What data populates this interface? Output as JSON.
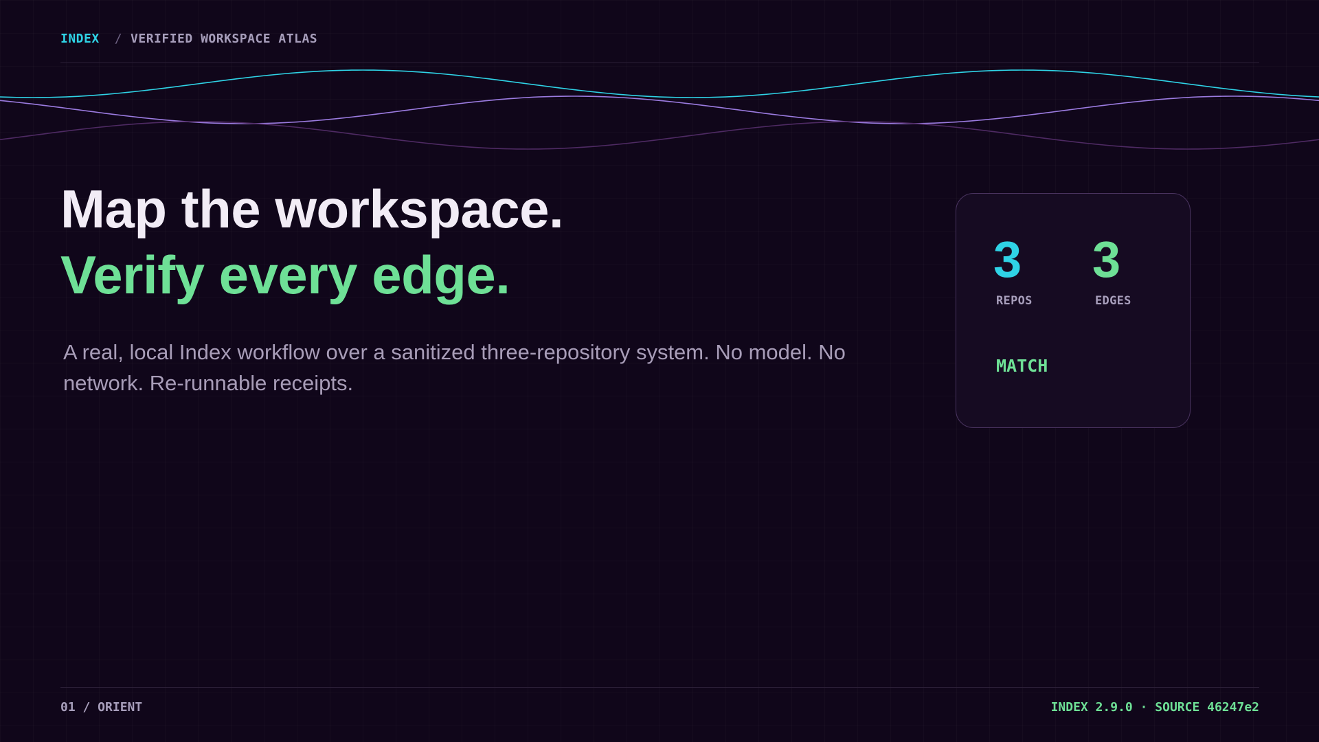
{
  "breadcrumb": {
    "root": "INDEX",
    "separator": "/",
    "page": "VERIFIED WORKSPACE ATLAS"
  },
  "hero": {
    "line1": "Map the workspace.",
    "line2": "Verify every edge.",
    "lede": "A real, local Index workflow over a sanitized three-repository system. No model. No network. Re-runnable receipts."
  },
  "summary_card": {
    "repos": {
      "value": "3",
      "label": "REPOS"
    },
    "edges": {
      "value": "3",
      "label": "EDGES"
    },
    "status": "MATCH"
  },
  "footer": {
    "slide": "01 / ORIENT",
    "build": "INDEX 2.9.0 · SOURCE 46247e2"
  },
  "colors": {
    "background": "#10061a",
    "accent_cyan": "#2fd3e6",
    "accent_green": "#6ee096",
    "accent_violet": "#9b7be0",
    "accent_plum": "#4e2a63",
    "muted_text": "#a79ebb"
  }
}
